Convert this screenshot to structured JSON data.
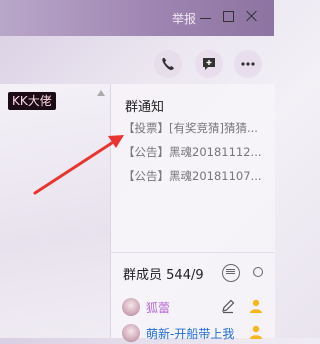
{
  "titlebar": {
    "report_label": "举报"
  },
  "toolbar": {
    "phone_icon": "phone-icon",
    "chat_icon": "chat-add-icon",
    "more_icon": "more-icon"
  },
  "chat": {
    "sender_badge": "KK大佬"
  },
  "notice": {
    "title": "群通知",
    "items": [
      {
        "tag": "【投票】",
        "text": "[有奖竞猜]猜猜..."
      },
      {
        "tag": "【公告】",
        "text": "黑魂20181112..."
      },
      {
        "tag": "【公告】",
        "text": "黑魂20181107..."
      }
    ]
  },
  "members": {
    "title": "群成员",
    "count": "544/9",
    "list": [
      {
        "name": "狐蕾"
      },
      {
        "name": "萌新-开船带上我"
      }
    ]
  },
  "colors": {
    "accent_arrow": "#e8352f",
    "member_purple": "#b56bd6",
    "member_blue": "#1e6fd9"
  }
}
